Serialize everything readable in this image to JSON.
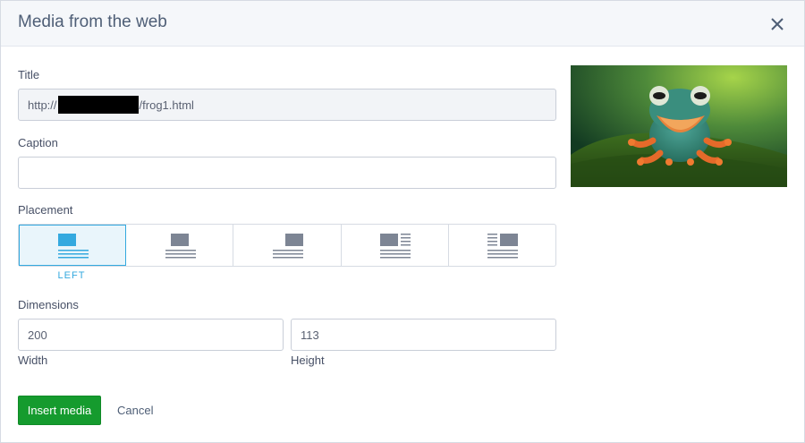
{
  "dialog": {
    "title": "Media from the web",
    "close_icon": "close-icon"
  },
  "title_field": {
    "label": "Title",
    "value_prefix": "http://",
    "value_suffix": "/frog1.html"
  },
  "caption_field": {
    "label": "Caption",
    "value": "",
    "placeholder": ""
  },
  "placement": {
    "label": "Placement",
    "selected_caption": "LEFT",
    "options": [
      {
        "icon": "align-left-icon",
        "active": true
      },
      {
        "icon": "align-center-icon",
        "active": false
      },
      {
        "icon": "align-right-icon",
        "active": false
      },
      {
        "icon": "wrap-left-icon",
        "active": false
      },
      {
        "icon": "wrap-right-icon",
        "active": false
      }
    ]
  },
  "dimensions": {
    "label": "Dimensions",
    "width_value": "200",
    "height_value": "113",
    "width_label": "Width",
    "height_label": "Height"
  },
  "actions": {
    "insert_label": "Insert media",
    "cancel_label": "Cancel"
  },
  "colors": {
    "accent": "#34a9df",
    "primary_button": "#159b2e",
    "header_bg": "#f5f7fa"
  }
}
